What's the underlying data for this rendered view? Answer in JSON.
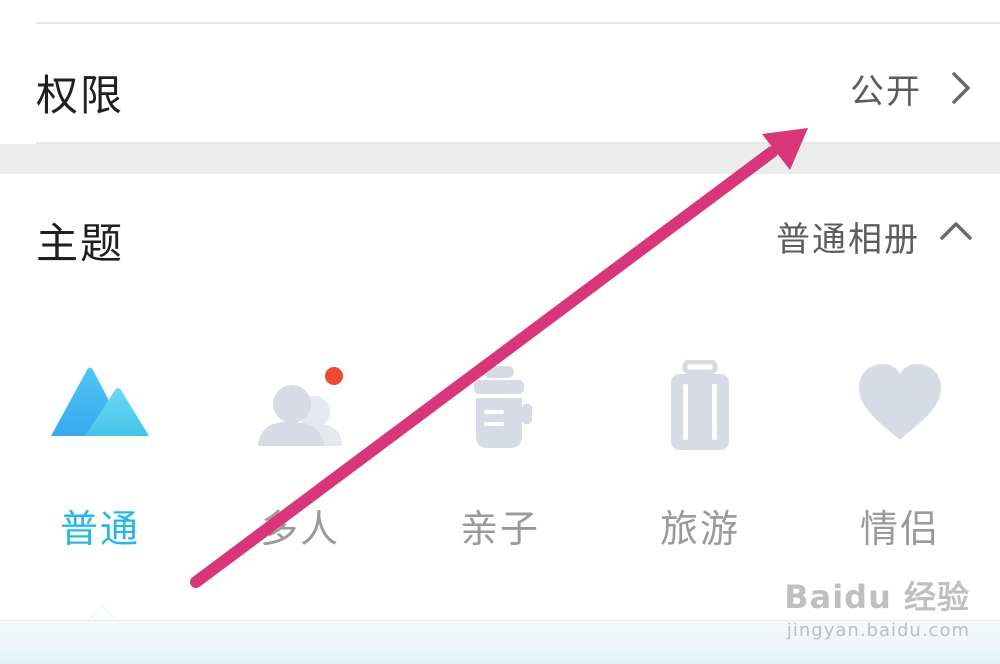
{
  "permission_row": {
    "title": "权限",
    "value": "公开"
  },
  "theme_row": {
    "title": "主题",
    "value": "普通相册"
  },
  "theme_options": [
    {
      "label": "普通",
      "icon": "mountain-icon",
      "selected": true
    },
    {
      "label": "多人",
      "icon": "people-icon",
      "selected": false,
      "badge": true
    },
    {
      "label": "亲子",
      "icon": "baby-bottle-icon",
      "selected": false
    },
    {
      "label": "旅游",
      "icon": "suitcase-icon",
      "selected": false
    },
    {
      "label": "情侣",
      "icon": "heart-icon",
      "selected": false
    }
  ],
  "watermark": {
    "main": "Baidu 经验",
    "sub": "jingyan.baidu.com"
  },
  "colors": {
    "accent": "#25b7e5",
    "icon_inactive": "#d7dbe6",
    "badge": "#ee4a33",
    "annotation_arrow": "#d9367a"
  }
}
